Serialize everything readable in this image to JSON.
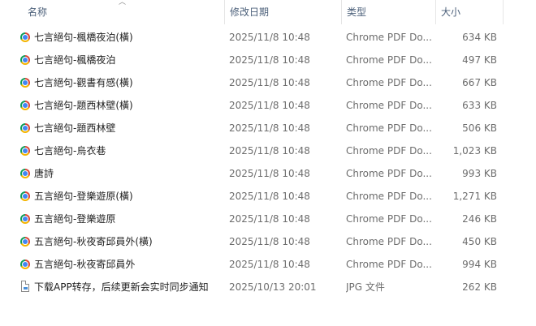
{
  "columns": {
    "name": "名称",
    "date": "修改日期",
    "type": "类型",
    "size": "大小"
  },
  "files": [
    {
      "name": "七言絕句-楓橋夜泊(橫)",
      "date": "2025/11/8 10:48",
      "type": "Chrome PDF Do...",
      "size": "634 KB",
      "icon": "chrome-pdf-icon"
    },
    {
      "name": "七言絕句-楓橋夜泊",
      "date": "2025/11/8 10:48",
      "type": "Chrome PDF Do...",
      "size": "497 KB",
      "icon": "chrome-pdf-icon"
    },
    {
      "name": "七言絕句-觀書有感(橫)",
      "date": "2025/11/8 10:48",
      "type": "Chrome PDF Do...",
      "size": "667 KB",
      "icon": "chrome-pdf-icon"
    },
    {
      "name": "七言絕句-題西林壁(橫)",
      "date": "2025/11/8 10:48",
      "type": "Chrome PDF Do...",
      "size": "633 KB",
      "icon": "chrome-pdf-icon"
    },
    {
      "name": "七言絕句-題西林壁",
      "date": "2025/11/8 10:48",
      "type": "Chrome PDF Do...",
      "size": "506 KB",
      "icon": "chrome-pdf-icon"
    },
    {
      "name": "七言絕句-烏衣巷",
      "date": "2025/11/8 10:48",
      "type": "Chrome PDF Do...",
      "size": "1,023 KB",
      "icon": "chrome-pdf-icon"
    },
    {
      "name": "唐詩",
      "date": "2025/11/8 10:48",
      "type": "Chrome PDF Do...",
      "size": "993 KB",
      "icon": "chrome-pdf-icon"
    },
    {
      "name": "五言絕句-登樂遊原(橫)",
      "date": "2025/11/8 10:48",
      "type": "Chrome PDF Do...",
      "size": "1,271 KB",
      "icon": "chrome-pdf-icon"
    },
    {
      "name": "五言絕句-登樂遊原",
      "date": "2025/11/8 10:48",
      "type": "Chrome PDF Do...",
      "size": "246 KB",
      "icon": "chrome-pdf-icon"
    },
    {
      "name": "五言絕句-秋夜寄邱員外(橫)",
      "date": "2025/11/8 10:48",
      "type": "Chrome PDF Do...",
      "size": "450 KB",
      "icon": "chrome-pdf-icon"
    },
    {
      "name": "五言絕句-秋夜寄邱員外",
      "date": "2025/11/8 10:48",
      "type": "Chrome PDF Do...",
      "size": "994 KB",
      "icon": "chrome-pdf-icon"
    },
    {
      "name": "下载APP转存，后续更新会实时同步通知",
      "date": "2025/10/13 20:01",
      "type": "JPG 文件",
      "size": "262 KB",
      "icon": "jpg-file-icon"
    }
  ]
}
